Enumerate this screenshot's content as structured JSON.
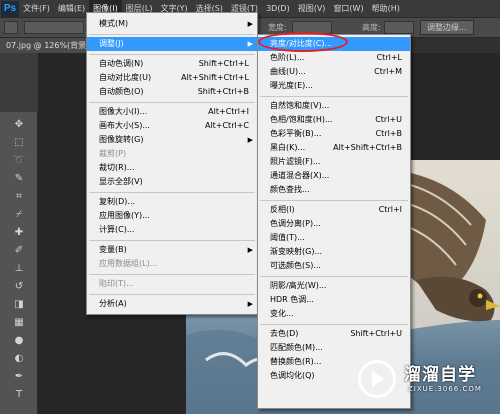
{
  "app": {
    "logo": "Ps"
  },
  "menubar": [
    "文件(F)",
    "编辑(E)",
    "图像(I)",
    "图层(L)",
    "文字(Y)",
    "选择(S)",
    "滤镜(T)",
    "3D(D)",
    "视图(V)",
    "窗口(W)",
    "帮助(H)"
  ],
  "options_bar": {
    "width_label": "宽度:",
    "height_label": "高度:",
    "adjust_edge_button": "调整边缘..."
  },
  "document_tab": "07.jpg @ 126%(背景 副本 ...",
  "image_menu": {
    "items": [
      {
        "label": "模式(M)",
        "shortcut": "",
        "submenu": true
      },
      {
        "label": "调整(J)",
        "shortcut": "",
        "submenu": true,
        "highlighted": true
      },
      {
        "label": "自动色调(N)",
        "shortcut": "Shift+Ctrl+L"
      },
      {
        "label": "自动对比度(U)",
        "shortcut": "Alt+Shift+Ctrl+L"
      },
      {
        "label": "自动颜色(O)",
        "shortcut": "Shift+Ctrl+B"
      },
      {
        "label": "图像大小(I)...",
        "shortcut": "Alt+Ctrl+I"
      },
      {
        "label": "画布大小(S)...",
        "shortcut": "Alt+Ctrl+C"
      },
      {
        "label": "图像旋转(G)",
        "shortcut": "",
        "submenu": true
      },
      {
        "label": "裁剪(P)",
        "shortcut": "",
        "disabled": true
      },
      {
        "label": "裁切(R)...",
        "shortcut": ""
      },
      {
        "label": "显示全部(V)",
        "shortcut": ""
      },
      {
        "label": "复制(D)...",
        "shortcut": ""
      },
      {
        "label": "应用图像(Y)...",
        "shortcut": ""
      },
      {
        "label": "计算(C)...",
        "shortcut": ""
      },
      {
        "label": "变量(B)",
        "shortcut": "",
        "submenu": true
      },
      {
        "label": "应用数据组(L)...",
        "shortcut": "",
        "disabled": true
      },
      {
        "label": "陷印(T)...",
        "shortcut": "",
        "disabled": true
      },
      {
        "label": "分析(A)",
        "shortcut": "",
        "submenu": true
      }
    ]
  },
  "adjust_menu": {
    "items": [
      {
        "label": "亮度/对比度(C)...",
        "shortcut": "",
        "highlighted": true
      },
      {
        "label": "色阶(L)...",
        "shortcut": "Ctrl+L"
      },
      {
        "label": "曲线(U)...",
        "shortcut": "Ctrl+M"
      },
      {
        "label": "曝光度(E)...",
        "shortcut": ""
      },
      {
        "label": "自然饱和度(V)...",
        "shortcut": ""
      },
      {
        "label": "色相/饱和度(H)...",
        "shortcut": "Ctrl+U"
      },
      {
        "label": "色彩平衡(B)...",
        "shortcut": "Ctrl+B"
      },
      {
        "label": "黑白(K)...",
        "shortcut": "Alt+Shift+Ctrl+B"
      },
      {
        "label": "照片滤镜(F)...",
        "shortcut": ""
      },
      {
        "label": "通道混合器(X)...",
        "shortcut": ""
      },
      {
        "label": "颜色查找...",
        "shortcut": ""
      },
      {
        "label": "反相(I)",
        "shortcut": "Ctrl+I"
      },
      {
        "label": "色调分离(P)...",
        "shortcut": ""
      },
      {
        "label": "阈值(T)...",
        "shortcut": ""
      },
      {
        "label": "渐变映射(G)...",
        "shortcut": ""
      },
      {
        "label": "可选颜色(S)...",
        "shortcut": ""
      },
      {
        "label": "阴影/高光(W)...",
        "shortcut": ""
      },
      {
        "label": "HDR 色调...",
        "shortcut": ""
      },
      {
        "label": "变化...",
        "shortcut": ""
      },
      {
        "label": "去色(D)",
        "shortcut": "Shift+Ctrl+U"
      },
      {
        "label": "匹配颜色(M)...",
        "shortcut": ""
      },
      {
        "label": "替换颜色(R)...",
        "shortcut": ""
      },
      {
        "label": "色调均化(Q)",
        "shortcut": ""
      }
    ]
  },
  "watermark": {
    "title": "溜溜自学",
    "url": "ZIXUE.3066.COM"
  }
}
